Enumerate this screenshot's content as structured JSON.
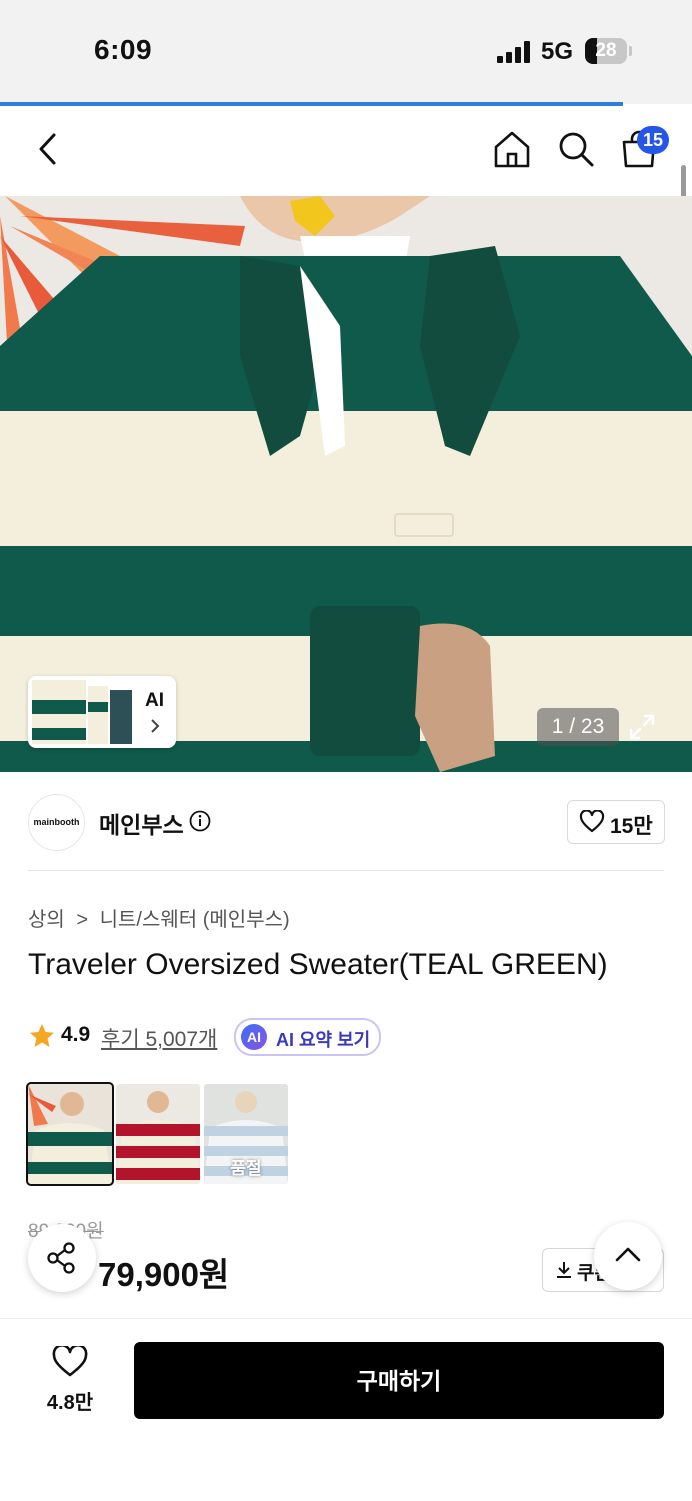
{
  "status_bar": {
    "time": "6:09",
    "network": "5G",
    "battery": "28",
    "battery_level": 0.28
  },
  "page_load_progress": 0.9,
  "header": {
    "cart_count": "15"
  },
  "hero": {
    "counter": "1 / 23",
    "ai_thumb_label": "AI"
  },
  "brand": {
    "logo_text": "mainbooth",
    "name": "메인부스",
    "likes": "15만"
  },
  "product": {
    "breadcrumb": [
      "상의",
      "니트/스웨터 (메인부스)"
    ],
    "title": "Traveler Oversized Sweater(TEAL GREEN)",
    "rating": "4.9",
    "reviews": "후기 5,007개",
    "ai_summary": "AI 요약 보기",
    "ai_badge": "AI",
    "original_price": "89,900원",
    "price": "79,900원",
    "coupon": "쿠폰",
    "soldout_label": "품절"
  },
  "colors": {
    "teal": "#0f5a4a",
    "cream": "#f4efdd",
    "red": "#b3132b",
    "sky": "#a9c3d8",
    "accent_blue": "#2457e8"
  },
  "bottom_bar": {
    "likes": "4.8만",
    "buy_label": "구매하기"
  }
}
